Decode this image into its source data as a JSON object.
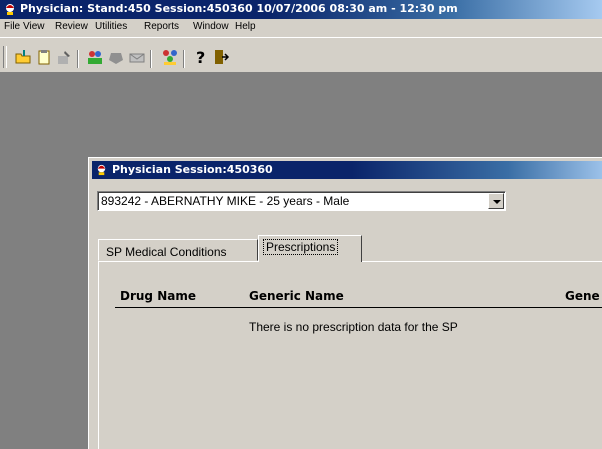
{
  "main_window": {
    "title": "Physician: Stand:450 Session:450360 10/07/2006 08:30 am - 12:30 pm",
    "menu": [
      "File",
      "View",
      "Review",
      "Utilities",
      "Reports",
      "Window",
      "Help"
    ],
    "toolbar_icons": [
      "open-folder-icon",
      "clipboard-icon",
      "edit-icon",
      "people-search-icon",
      "shape-icon",
      "mail-icon",
      "multiple-users-icon",
      "help-icon",
      "exit-icon"
    ]
  },
  "session_window": {
    "title": "Physician Session:450360",
    "participant_select": {
      "value": "893242 - ABERNATHY MIKE - 25  years  - Male"
    },
    "tabs": [
      {
        "label": "SP Medical Conditions",
        "active": false
      },
      {
        "label": "Prescriptions",
        "active": true
      }
    ],
    "table": {
      "columns": [
        "Drug Name",
        "Generic Name",
        "Gene"
      ],
      "empty_message": "There is no prescription data for the SP"
    }
  },
  "colors": {
    "titlebar": "#0a246a",
    "face": "#d4d0c8",
    "mdi_background": "#808080"
  }
}
